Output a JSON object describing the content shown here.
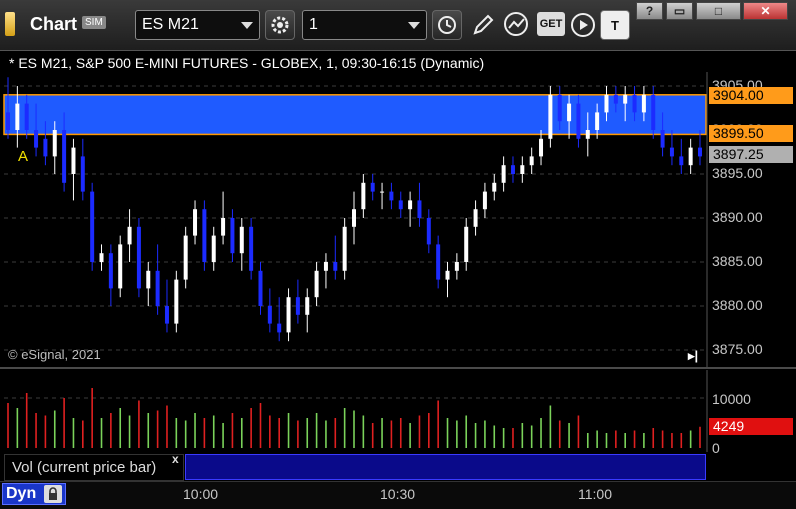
{
  "window": {
    "title": "Chart",
    "sim_badge": "SIM"
  },
  "toolbar": {
    "symbol": "ES M21",
    "interval": "1",
    "get_label": "GET",
    "icons": [
      "link-gear-icon",
      "clock-icon",
      "pencil-icon",
      "indicator-icon",
      "get-data-icon",
      "play-icon",
      "text-icon"
    ]
  },
  "window_controls": [
    "help",
    "restore",
    "maximize",
    "close"
  ],
  "chart": {
    "header": "* ES M21, S&P 500 E-MINI FUTURES - GLOBEX, 1, 09:30-16:15 (Dynamic)",
    "copyright": "© eSignal, 2021",
    "marker_label": "A",
    "price_ticks": [
      "3905.00",
      "3900.00",
      "3895.00",
      "3890.00",
      "3885.00",
      "3880.00",
      "3875.00"
    ],
    "zone": {
      "upper": "3904.00",
      "lower": "3899.50",
      "color": "#1f5bff",
      "border": "#ff9900"
    },
    "last_price": "3897.25",
    "colors": {
      "up": "#ffffff",
      "down": "#1c2bff",
      "vol_up": "#7bd35a",
      "vol_down": "#e02020"
    }
  },
  "volume_pane": {
    "title": "Vol (current price bar)",
    "ticks": [
      "10000",
      "0"
    ],
    "last_volume": "4249",
    "close_label": "x"
  },
  "time_axis": {
    "mode_label": "Dyn",
    "labels": [
      "10:00",
      "10:30",
      "11:00"
    ]
  },
  "chart_data": {
    "type": "candlestick",
    "ylim": [
      3874,
      3907
    ],
    "price_bars": [
      [
        3902,
        3906,
        3899,
        3900
      ],
      [
        3900,
        3905,
        3898,
        3903
      ],
      [
        3903,
        3904,
        3899,
        3900
      ],
      [
        3900,
        3903,
        3897,
        3898
      ],
      [
        3899,
        3901,
        3896,
        3897
      ],
      [
        3897,
        3901,
        3895,
        3900
      ],
      [
        3900,
        3902,
        3893,
        3894
      ],
      [
        3895,
        3899,
        3892,
        3898
      ],
      [
        3897,
        3899,
        3892,
        3893
      ],
      [
        3893,
        3894,
        3884,
        3885
      ],
      [
        3885,
        3887,
        3884,
        3886
      ],
      [
        3886,
        3887,
        3880,
        3882
      ],
      [
        3882,
        3888,
        3881,
        3887
      ],
      [
        3887,
        3891,
        3885,
        3889
      ],
      [
        3889,
        3890,
        3881,
        3882
      ],
      [
        3882,
        3885,
        3880,
        3884
      ],
      [
        3884,
        3887,
        3879,
        3880
      ],
      [
        3880,
        3883,
        3877,
        3878
      ],
      [
        3878,
        3884,
        3877,
        3883
      ],
      [
        3883,
        3889,
        3882,
        3888
      ],
      [
        3888,
        3892,
        3887,
        3891
      ],
      [
        3891,
        3892,
        3884,
        3885
      ],
      [
        3885,
        3889,
        3884,
        3888
      ],
      [
        3888,
        3893,
        3887,
        3890
      ],
      [
        3890,
        3891,
        3885,
        3886
      ],
      [
        3886,
        3890,
        3884,
        3889
      ],
      [
        3889,
        3890,
        3883,
        3884
      ],
      [
        3884,
        3885,
        3879,
        3880
      ],
      [
        3880,
        3882,
        3877,
        3878
      ],
      [
        3878,
        3881,
        3876,
        3877
      ],
      [
        3877,
        3882,
        3876,
        3881
      ],
      [
        3881,
        3883,
        3878,
        3879
      ],
      [
        3879,
        3882,
        3877,
        3881
      ],
      [
        3881,
        3885,
        3880,
        3884
      ],
      [
        3884,
        3886,
        3882,
        3885
      ],
      [
        3885,
        3888,
        3883,
        3884
      ],
      [
        3884,
        3890,
        3883,
        3889
      ],
      [
        3889,
        3893,
        3887,
        3891
      ],
      [
        3891,
        3895,
        3890,
        3894
      ],
      [
        3894,
        3895,
        3892,
        3893
      ],
      [
        3893,
        3894,
        3891,
        3893
      ],
      [
        3893,
        3894,
        3891,
        3892
      ],
      [
        3892,
        3893,
        3890,
        3891
      ],
      [
        3891,
        3893,
        3889,
        3892
      ],
      [
        3892,
        3894,
        3889,
        3890
      ],
      [
        3890,
        3891,
        3886,
        3887
      ],
      [
        3887,
        3888,
        3882,
        3883
      ],
      [
        3883,
        3885,
        3881,
        3884
      ],
      [
        3884,
        3886,
        3883,
        3885
      ],
      [
        3885,
        3890,
        3884,
        3889
      ],
      [
        3889,
        3892,
        3888,
        3891
      ],
      [
        3891,
        3894,
        3890,
        3893
      ],
      [
        3893,
        3895,
        3892,
        3894
      ],
      [
        3894,
        3897,
        3893,
        3896
      ],
      [
        3896,
        3897,
        3894,
        3895
      ],
      [
        3895,
        3897,
        3894,
        3896
      ],
      [
        3896,
        3898,
        3895,
        3897
      ],
      [
        3897,
        3900,
        3896,
        3899
      ],
      [
        3899,
        3905,
        3898,
        3904
      ],
      [
        3904,
        3905,
        3900,
        3901
      ],
      [
        3901,
        3904,
        3899,
        3903
      ],
      [
        3903,
        3904,
        3898,
        3899
      ],
      [
        3899,
        3902,
        3897,
        3900
      ],
      [
        3900,
        3903,
        3899,
        3902
      ],
      [
        3902,
        3905,
        3901,
        3904
      ],
      [
        3904,
        3905,
        3902,
        3903
      ],
      [
        3903,
        3905,
        3901,
        3904
      ],
      [
        3904,
        3905,
        3901,
        3902
      ],
      [
        3902,
        3905,
        3901,
        3904
      ],
      [
        3904,
        3905,
        3899,
        3900
      ],
      [
        3900,
        3902,
        3897,
        3898
      ],
      [
        3898,
        3900,
        3896,
        3897
      ],
      [
        3897,
        3899,
        3895,
        3896
      ],
      [
        3896,
        3899,
        3895,
        3898
      ],
      [
        3898,
        3900,
        3896,
        3897
      ]
    ],
    "volume": [
      9000,
      8000,
      11000,
      7000,
      6500,
      7500,
      10000,
      6000,
      5500,
      12000,
      6000,
      7000,
      8000,
      6500,
      9500,
      7000,
      7500,
      8500,
      6000,
      5500,
      7000,
      6000,
      6500,
      5000,
      7000,
      6000,
      8000,
      9000,
      6500,
      6000,
      7000,
      5500,
      6000,
      7000,
      5500,
      6000,
      8000,
      7500,
      6500,
      5000,
      6000,
      5500,
      6000,
      5000,
      6500,
      7000,
      9500,
      6000,
      5500,
      6500,
      5000,
      5500,
      4500,
      4000,
      4000,
      5000,
      4500,
      6000,
      8500,
      5500,
      5000,
      6500,
      3000,
      3500,
      3000,
      3500,
      3000,
      3500,
      3000,
      4000,
      3500,
      3000,
      3000,
      3500,
      4249
    ]
  }
}
